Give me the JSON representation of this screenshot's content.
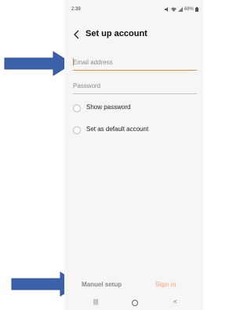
{
  "status_bar": {
    "time": "2:39",
    "battery_text": "68%"
  },
  "header": {
    "title": "Set up account"
  },
  "form": {
    "email_placeholder": "Email address",
    "password_placeholder": "Password",
    "show_password_label": "Show password",
    "default_account_label": "Set as default account"
  },
  "actions": {
    "manual_setup_label": "Manuel setup",
    "sign_in_label": "Sign in"
  },
  "nav_bar": {
    "recent_glyph": "|||",
    "back_glyph": "<"
  },
  "colors": {
    "accent": "#e58a3a",
    "sign_in_disabled": "#f5b89a",
    "annotation_arrow": "#3b62a8"
  },
  "icons": [
    "back-chevron-icon",
    "mute-icon",
    "wifi-icon",
    "signal-icon",
    "battery-icon",
    "recent-apps-icon",
    "home-icon",
    "nav-back-icon",
    "annotation-arrow-icon"
  ]
}
